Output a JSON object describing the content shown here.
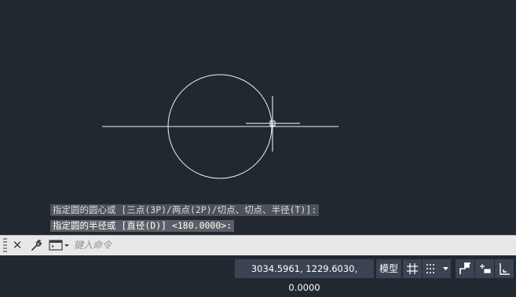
{
  "command_history": [
    "指定圆的圆心或 [三点(3P)/两点(2P)/切点、切点、半径(T)]:",
    "指定圆的半径或 [直径(D)] <180.0000>:"
  ],
  "command_line": {
    "placeholder": "键入命令",
    "icons": [
      "close-icon",
      "wrench-icon",
      "command-prompt-icon",
      "chevron-down-icon"
    ]
  },
  "status_bar": {
    "coordinates": "3034.5961, 1229.6030, 0.0000",
    "model_label": "模型",
    "icons": [
      "grid-icon",
      "snap-icon",
      "chevron-down-icon",
      "ortho-icon",
      "dynamic-input-icon",
      "ucs-icon"
    ]
  },
  "colors": {
    "canvas_background": "#212830",
    "geometry": "#ffffff",
    "command_bar": "#e8e8e8",
    "status_button": "#3b4453"
  }
}
